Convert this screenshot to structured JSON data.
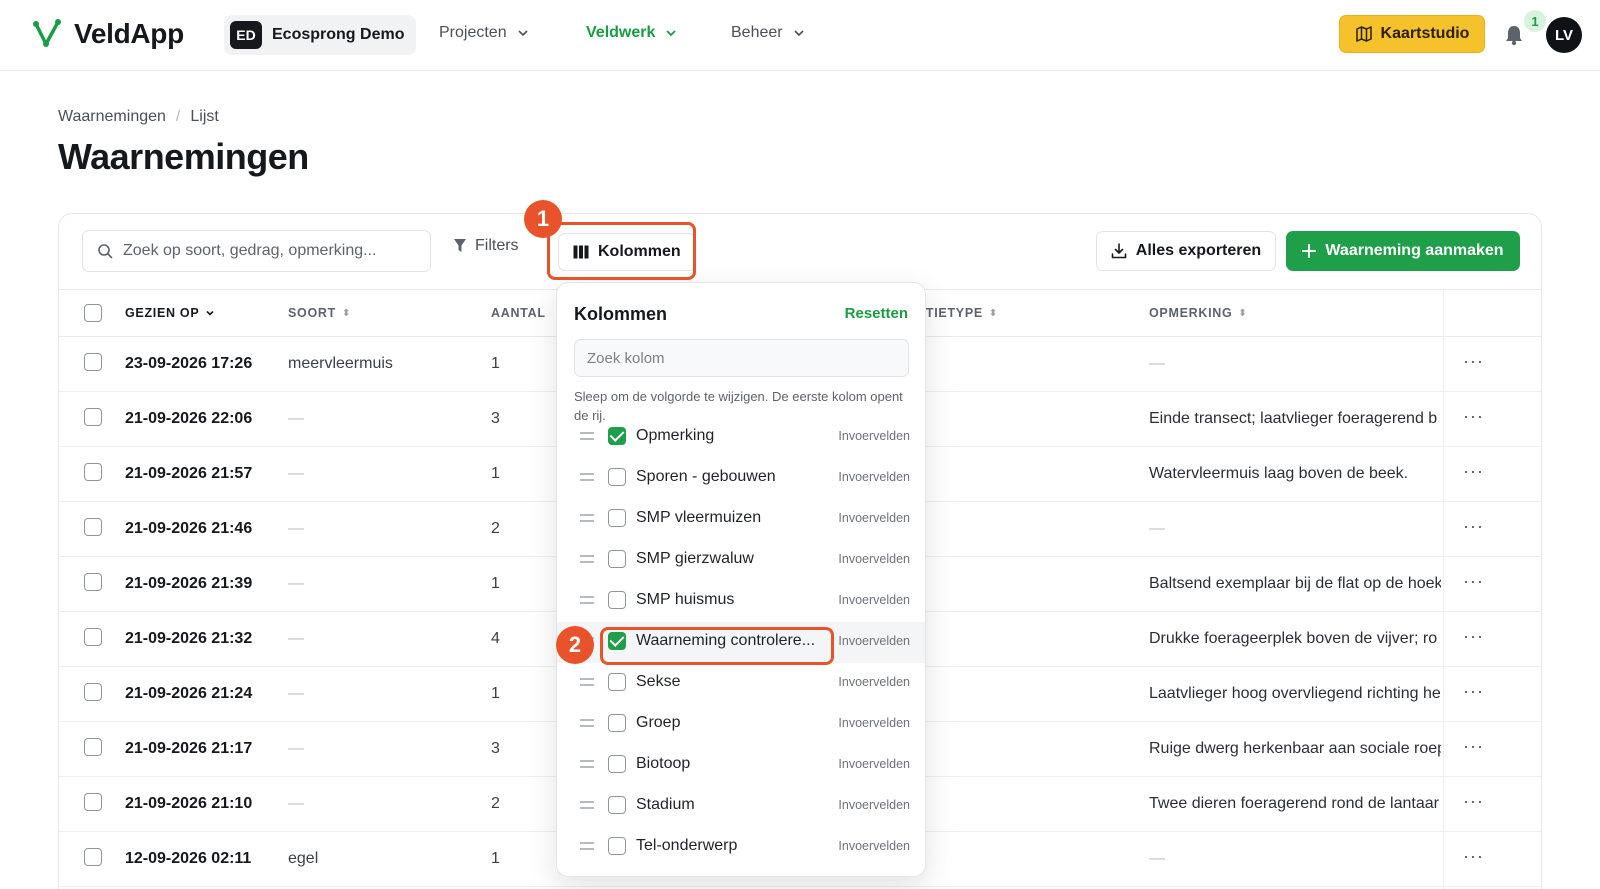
{
  "app": {
    "name": "VeldApp",
    "org_initials": "ED",
    "org_name": "Ecosprong Demo",
    "nav": [
      "Projecten",
      "Veldwerk",
      "Beheer"
    ],
    "kaartstudio_label": "Kaartstudio",
    "notification_count": "1",
    "user_initials": "LV",
    "accent_color": "#1f9f49",
    "highlight_color": "#f6c22c"
  },
  "breadcrumb": [
    "Waarnemingen",
    "Lijst"
  ],
  "page_title": "Waarnemingen",
  "toolbar": {
    "search_placeholder": "Zoek op soort, gedrag, opmerking...",
    "filters_label": "Filters",
    "columns_label": "Kolommen",
    "export_label": "Alles exporteren",
    "create_label": "Waarneming aanmaken"
  },
  "table": {
    "headers": {
      "gezien_op": "GEZIEN OP",
      "soort": "SOORT",
      "aantal": "AANTAL",
      "observatietype": "VATIETYPE",
      "opmerking": "OPMERKING"
    },
    "rows": [
      {
        "date": "23-09-2026 17:26",
        "soort": "meervleermuis",
        "aantal": "1",
        "opmerking": "—"
      },
      {
        "date": "21-09-2026 22:06",
        "soort": "—",
        "aantal": "3",
        "opmerking": "Einde transect; laatvlieger foeragerend b"
      },
      {
        "date": "21-09-2026 21:57",
        "soort": "—",
        "aantal": "1",
        "opmerking": "Watervleermuis laag boven de beek."
      },
      {
        "date": "21-09-2026 21:46",
        "soort": "—",
        "aantal": "2",
        "opmerking": "—"
      },
      {
        "date": "21-09-2026 21:39",
        "soort": "—",
        "aantal": "1",
        "opmerking": "Baltsend exemplaar bij de flat op de hoek"
      },
      {
        "date": "21-09-2026 21:32",
        "soort": "—",
        "aantal": "4",
        "opmerking": "Drukke foerageerplek boven de vijver; ro"
      },
      {
        "date": "21-09-2026 21:24",
        "soort": "—",
        "aantal": "1",
        "opmerking": "Laatvlieger hoog overvliegend richting he"
      },
      {
        "date": "21-09-2026 21:17",
        "soort": "—",
        "aantal": "3",
        "opmerking": "Ruige dwerg herkenbaar aan sociale roep"
      },
      {
        "date": "21-09-2026 21:10",
        "soort": "—",
        "aantal": "2",
        "opmerking": "Twee dieren foeragerend rond de lantaar"
      },
      {
        "date": "12-09-2026 02:11",
        "soort": "egel",
        "aantal": "1",
        "opmerking": "—"
      }
    ],
    "more_label": "···"
  },
  "columns_panel": {
    "title": "Kolommen",
    "reset_label": "Resetten",
    "search_placeholder": "Zoek kolom",
    "hint": "Sleep om de volgorde te wijzigen. De eerste kolom opent de rij.",
    "items": [
      {
        "name": "Opmerking",
        "group": "Invoervelden",
        "checked": true
      },
      {
        "name": "Sporen - gebouwen",
        "group": "Invoervelden",
        "checked": false
      },
      {
        "name": "SMP vleermuizen",
        "group": "Invoervelden",
        "checked": false
      },
      {
        "name": "SMP gierzwaluw",
        "group": "Invoervelden",
        "checked": false
      },
      {
        "name": "SMP huismus",
        "group": "Invoervelden",
        "checked": false
      },
      {
        "name": "Waarneming controlere...",
        "group": "Invoervelden",
        "checked": true
      },
      {
        "name": "Sekse",
        "group": "Invoervelden",
        "checked": false
      },
      {
        "name": "Groep",
        "group": "Invoervelden",
        "checked": false
      },
      {
        "name": "Biotoop",
        "group": "Invoervelden",
        "checked": false
      },
      {
        "name": "Stadium",
        "group": "Invoervelden",
        "checked": false
      },
      {
        "name": "Tel-onderwerp",
        "group": "Invoervelden",
        "checked": false
      }
    ]
  },
  "annotations": [
    "1",
    "2"
  ]
}
